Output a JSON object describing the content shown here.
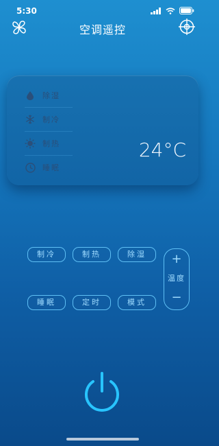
{
  "status_bar": {
    "time": "5:30",
    "icons": [
      "cellular-signal-icon",
      "wifi-icon",
      "battery-icon"
    ]
  },
  "nav": {
    "title": "空调遥控",
    "left_icon": "fan-icon",
    "right_icon": "crosshair-icon"
  },
  "panel": {
    "modes": [
      {
        "label": "除湿",
        "icon": "droplet-icon"
      },
      {
        "label": "制冷",
        "icon": "snowflake-icon"
      },
      {
        "label": "制热",
        "icon": "sun-icon"
      },
      {
        "label": "睡眠",
        "icon": "clock-icon"
      }
    ],
    "temperature": "24°C"
  },
  "controls": {
    "cool": "制冷",
    "heat": "制热",
    "dehumidify": "除湿",
    "sleep": "睡眠",
    "timer": "定时",
    "mode": "模式",
    "temp_plus": "+",
    "temp_label": "温度",
    "temp_minus": "−"
  },
  "colors": {
    "accent": "#5fc0f5",
    "power": "#28c4ff",
    "background_top": "#1e8fd0",
    "background_bottom": "#0a4a8a"
  }
}
